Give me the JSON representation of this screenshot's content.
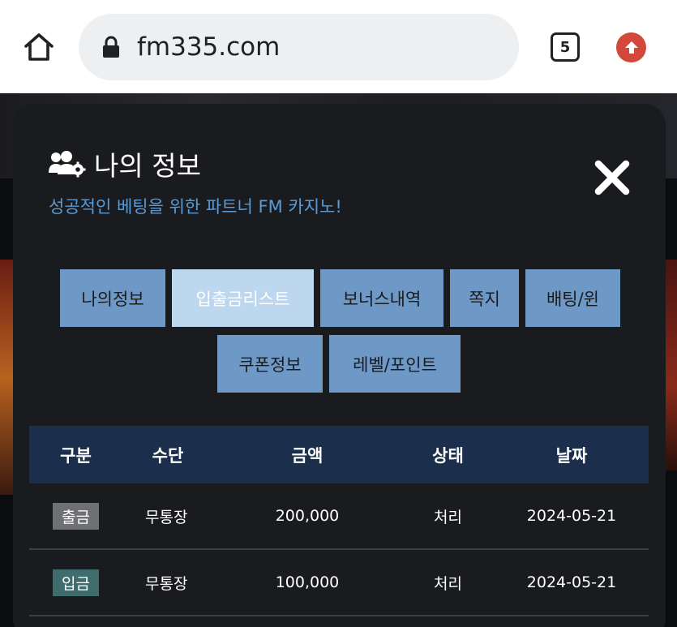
{
  "browser": {
    "url": "fm335.com",
    "tab_count": "5"
  },
  "modal": {
    "title": "나의 정보",
    "subtitle": "성공적인 베팅을 위한 파트너 FM 카지노!",
    "tabs_row1": [
      "나의정보",
      "입출금리스트",
      "보너스내역",
      "쪽지",
      "배팅/윈"
    ],
    "tabs_row2": [
      "쿠폰정보",
      "레벨/포인트"
    ],
    "active_tab": "입출금리스트"
  },
  "table": {
    "headers": [
      "구분",
      "수단",
      "금액",
      "상태",
      "날짜"
    ],
    "rows": [
      {
        "type": "출금",
        "type_color": "#6f7073",
        "method": "무통장",
        "amount": "200,000",
        "status": "처리",
        "date": "2024-05-21"
      },
      {
        "type": "입금",
        "type_color": "#3f6d6e",
        "method": "무통장",
        "amount": "100,000",
        "status": "처리",
        "date": "2024-05-21"
      }
    ]
  },
  "colors": {
    "accent_blue": "#5b9bd5",
    "tab_bg": "#6e98c6",
    "tab_active_bg": "#bcd7ee",
    "table_header_bg": "#1b2f4d",
    "update_badge": "#d2483b"
  },
  "icons": {
    "home": "home-icon",
    "lock": "lock-icon",
    "update": "update-arrow-icon",
    "title": "users-gear-icon",
    "close": "close-icon"
  }
}
